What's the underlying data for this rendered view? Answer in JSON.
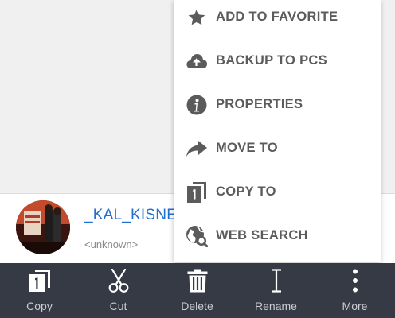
{
  "menu": {
    "items": [
      {
        "label": "ADD TO FAVORITE",
        "icon": "star-icon"
      },
      {
        "label": "BACKUP TO PCS",
        "icon": "cloud-upload-icon"
      },
      {
        "label": "PROPERTIES",
        "icon": "info-icon"
      },
      {
        "label": "MOVE TO",
        "icon": "forward-arrow-icon"
      },
      {
        "label": "COPY TO",
        "icon": "copy-icon"
      },
      {
        "label": "WEB SEARCH",
        "icon": "globe-search-icon"
      }
    ]
  },
  "file_row": {
    "title": "_KAL_KISNE",
    "subtitle": "<unknown>"
  },
  "bottom_bar": {
    "items": [
      {
        "label": "Copy",
        "icon": "copy-icon"
      },
      {
        "label": "Cut",
        "icon": "scissors-icon"
      },
      {
        "label": "Delete",
        "icon": "trash-icon"
      },
      {
        "label": "Rename",
        "icon": "text-cursor-icon"
      },
      {
        "label": "More",
        "icon": "more-vertical-icon"
      }
    ]
  },
  "colors": {
    "menu_text": "#5b5b5b",
    "link_blue": "#1e6fd0",
    "bottom_bar": "#363a44",
    "bottom_bar_text": "#c9ccd2"
  }
}
